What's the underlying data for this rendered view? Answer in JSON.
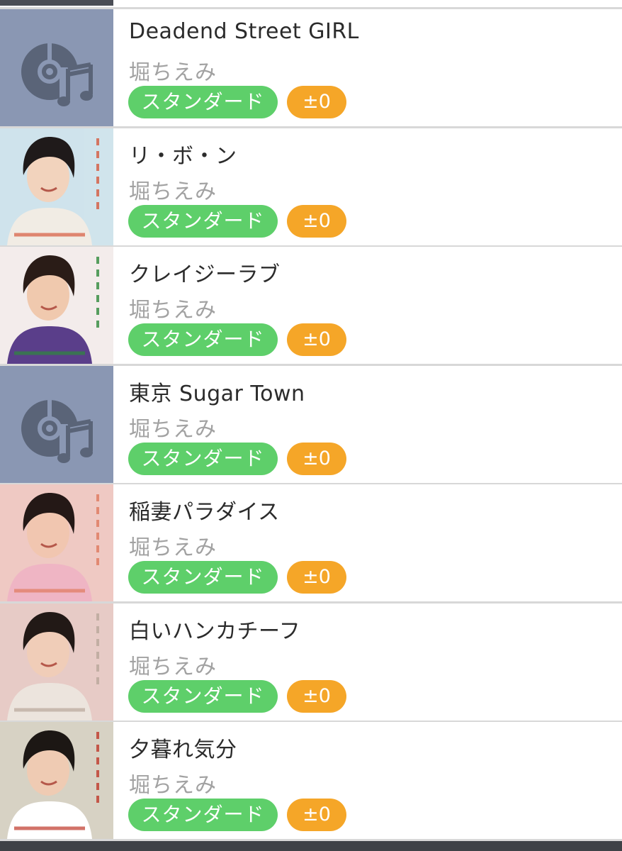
{
  "songs": [
    {
      "title": "Deadend Street GIRL",
      "artist": "堀ちえみ",
      "difficulty": "スタンダード",
      "delta": "±0",
      "cover": "placeholder"
    },
    {
      "title": "リ・ボ・ン",
      "artist": "堀ちえみ",
      "difficulty": "スタンダード",
      "delta": "±0",
      "cover": "photo",
      "palette": {
        "bg": "#cfe3ec",
        "hair": "#1f1a1a",
        "skin": "#f2d3bd",
        "outfit": "#f1ece4",
        "accent": "#d65a3f"
      }
    },
    {
      "title": "クレイジーラブ",
      "artist": "堀ちえみ",
      "difficulty": "スタンダード",
      "delta": "±0",
      "cover": "photo",
      "palette": {
        "bg": "#f3eceb",
        "hair": "#2a1c17",
        "skin": "#f0c9ae",
        "outfit": "#5a3e8a",
        "accent": "#2f8a3c"
      }
    },
    {
      "title": "東京 Sugar Town",
      "artist": "堀ちえみ",
      "difficulty": "スタンダード",
      "delta": "±0",
      "cover": "placeholder"
    },
    {
      "title": "稲妻パラダイス",
      "artist": "堀ちえみ",
      "difficulty": "スタンダード",
      "delta": "±0",
      "cover": "photo",
      "palette": {
        "bg": "#efc9c3",
        "hair": "#241816",
        "skin": "#f1c6b0",
        "outfit": "#efb5c4",
        "accent": "#e07a5f"
      }
    },
    {
      "title": "白いハンカチーフ",
      "artist": "堀ちえみ",
      "difficulty": "スタンダード",
      "delta": "±0",
      "cover": "photo",
      "palette": {
        "bg": "#e7cbc6",
        "hair": "#221916",
        "skin": "#f0cdb8",
        "outfit": "#ece4dd",
        "accent": "#b9a79b"
      }
    },
    {
      "title": "夕暮れ気分",
      "artist": "堀ちえみ",
      "difficulty": "スタンダード",
      "delta": "±0",
      "cover": "photo",
      "palette": {
        "bg": "#d7d2c4",
        "hair": "#1c1714",
        "skin": "#efcbb3",
        "outfit": "#ffffff",
        "accent": "#c0392b"
      }
    }
  ],
  "colors": {
    "standard_badge": "#5ecf6a",
    "delta_badge": "#f5a628",
    "placeholder_bg": "#8a97b3",
    "placeholder_icon": "#5a6478",
    "title_text": "#2b2b2b",
    "artist_text": "#a2a2a2"
  }
}
